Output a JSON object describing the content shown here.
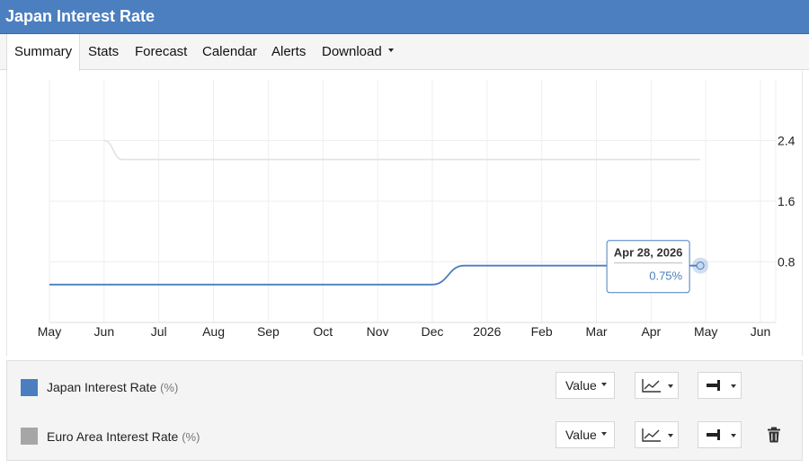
{
  "header": {
    "title": "Japan Interest Rate"
  },
  "tabs": [
    {
      "label": "Summary",
      "active": true
    },
    {
      "label": "Stats"
    },
    {
      "label": "Forecast"
    },
    {
      "label": "Calendar"
    },
    {
      "label": "Alerts"
    },
    {
      "label": "Download",
      "has_dropdown": true
    }
  ],
  "tooltip": {
    "date": "Apr 28, 2026",
    "value": "0.75%"
  },
  "legend": {
    "items": [
      {
        "name": "Japan Interest Rate",
        "unit": "(%)",
        "color": "#4a7ebf",
        "mode_label": "Value"
      },
      {
        "name": "Euro Area Interest Rate",
        "unit": "(%)",
        "color": "#a6a6a6",
        "mode_label": "Value"
      }
    ]
  },
  "icons": [
    "line-chart-icon",
    "axis-position-icon",
    "trash-icon",
    "caret-down-icon"
  ],
  "chart_data": {
    "type": "line",
    "title": "",
    "xlabel": "",
    "ylabel": "",
    "x_ticks": [
      "May",
      "Jun",
      "Jul",
      "Aug",
      "Sep",
      "Oct",
      "Nov",
      "Dec",
      "2026",
      "Feb",
      "Mar",
      "Apr",
      "May",
      "Jun"
    ],
    "y_ticks": [
      "2.4",
      "1.6",
      "0.8"
    ],
    "ylim": [
      0,
      3.2
    ],
    "y_axis_side": "right",
    "grid": true,
    "series": [
      {
        "name": "Japan Interest Rate",
        "color": "#4a7ebf",
        "points": [
          [
            "2025-05-01",
            0.5
          ],
          [
            "2025-12-01",
            0.5
          ],
          [
            "2025-12-19",
            0.75
          ],
          [
            "2026-04-28",
            0.75
          ]
        ]
      },
      {
        "name": "Euro Area Interest Rate",
        "color": "#e2e2e2",
        "points": [
          [
            "2025-06-01",
            2.4
          ],
          [
            "2025-06-11",
            2.15
          ],
          [
            "2026-04-28",
            2.15
          ]
        ]
      }
    ]
  }
}
